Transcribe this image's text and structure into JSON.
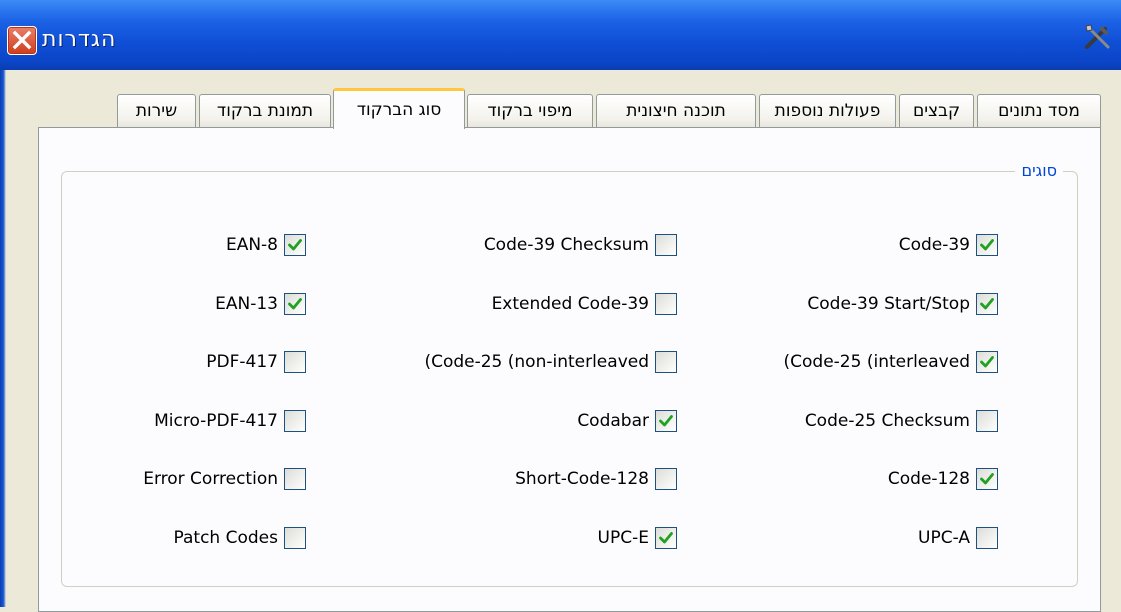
{
  "window": {
    "title": "הגדרות",
    "title_bar_color": "#0F4FD6",
    "close_icon": "close-icon",
    "tools_icon": "tools-icon"
  },
  "tabs": [
    {
      "label": "מסד נתונים",
      "active": false
    },
    {
      "label": "קבצים",
      "active": false
    },
    {
      "label": "פעולות נוספות",
      "active": false
    },
    {
      "label": "תוכנה חיצונית",
      "active": false
    },
    {
      "label": "מיפוי ברקוד",
      "active": false
    },
    {
      "label": "סוג הברקוד",
      "active": true
    },
    {
      "label": "תמונת ברקוד",
      "active": false
    },
    {
      "label": "שירות",
      "active": false
    }
  ],
  "group": {
    "legend": "סוגים",
    "legend_color": "#0046D5",
    "checkbox_check_color": "#21A121",
    "columns": [
      [
        {
          "label": "Code-39",
          "checked": true
        },
        {
          "label": "Code-39 Start/Stop",
          "checked": true
        },
        {
          "label": "(Code-25 (interleaved",
          "checked": true
        },
        {
          "label": "Code-25 Checksum",
          "checked": false
        },
        {
          "label": "Code-128",
          "checked": true
        },
        {
          "label": "UPC-A",
          "checked": false
        }
      ],
      [
        {
          "label": "Code-39 Checksum",
          "checked": false
        },
        {
          "label": "Extended Code-39",
          "checked": false
        },
        {
          "label": "(Code-25 (non-interleaved",
          "checked": false
        },
        {
          "label": "Codabar",
          "checked": true
        },
        {
          "label": "Short-Code-128",
          "checked": false
        },
        {
          "label": "UPC-E",
          "checked": true
        }
      ],
      [
        {
          "label": "EAN-8",
          "checked": true
        },
        {
          "label": "EAN-13",
          "checked": true
        },
        {
          "label": "PDF-417",
          "checked": false
        },
        {
          "label": "Micro-PDF-417",
          "checked": false
        },
        {
          "label": "Error Correction",
          "checked": false
        },
        {
          "label": "Patch Codes",
          "checked": false
        }
      ]
    ]
  }
}
